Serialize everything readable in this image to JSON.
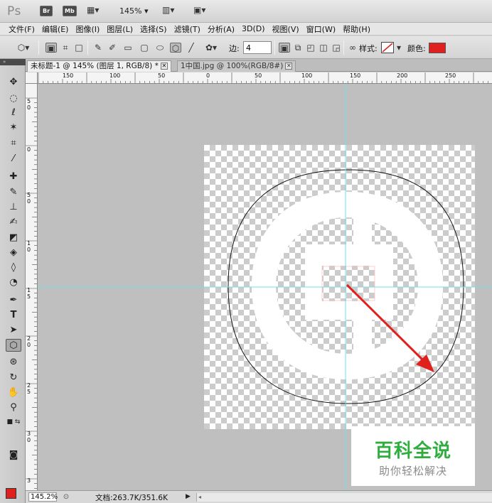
{
  "app": {
    "logo": "Ps",
    "top_buttons": [
      "Br",
      "Mb"
    ],
    "zoom_dropdown": "145% ▾"
  },
  "menu": {
    "items": [
      "文件(F)",
      "编辑(E)",
      "图像(I)",
      "图层(L)",
      "选择(S)",
      "滤镜(T)",
      "分析(A)",
      "3D(D)",
      "视图(V)",
      "窗口(W)",
      "帮助(H)"
    ]
  },
  "options": {
    "sides_label": "边:",
    "sides_value": "4",
    "style_label": "样式:",
    "color_label": "颜色:",
    "color_value": "#e0201c"
  },
  "tabs": [
    {
      "label": "未标题-1 @ 145% (图层 1, RGB/8) *",
      "close": "✕",
      "active": true
    },
    {
      "label": "1中国.jpg @ 100%(RGB/8#)",
      "close": "✕",
      "active": false
    }
  ],
  "ruler": {
    "top_labels": [
      "150",
      "100",
      "50",
      "0",
      "50",
      "100",
      "150",
      "200",
      "250"
    ],
    "left_labels": [
      "5",
      "0",
      "0",
      "5",
      "0",
      "1",
      "0",
      "1",
      "5",
      "2",
      "0",
      "2",
      "5",
      "3",
      "0",
      "3"
    ]
  },
  "canvas": {
    "arrow_color": "#e0201c",
    "guide_color": "#70e0e8"
  },
  "watermark": {
    "title": "百科全说",
    "subtitle": "助你轻松解决"
  },
  "status": {
    "zoom": "145.2%",
    "doc": "文档:263.7K/351.6K",
    "play": "▶",
    "scroll": "◂"
  },
  "toolbox": {
    "fg_color": "#e0201c",
    "bg_color": "#ffffff"
  }
}
